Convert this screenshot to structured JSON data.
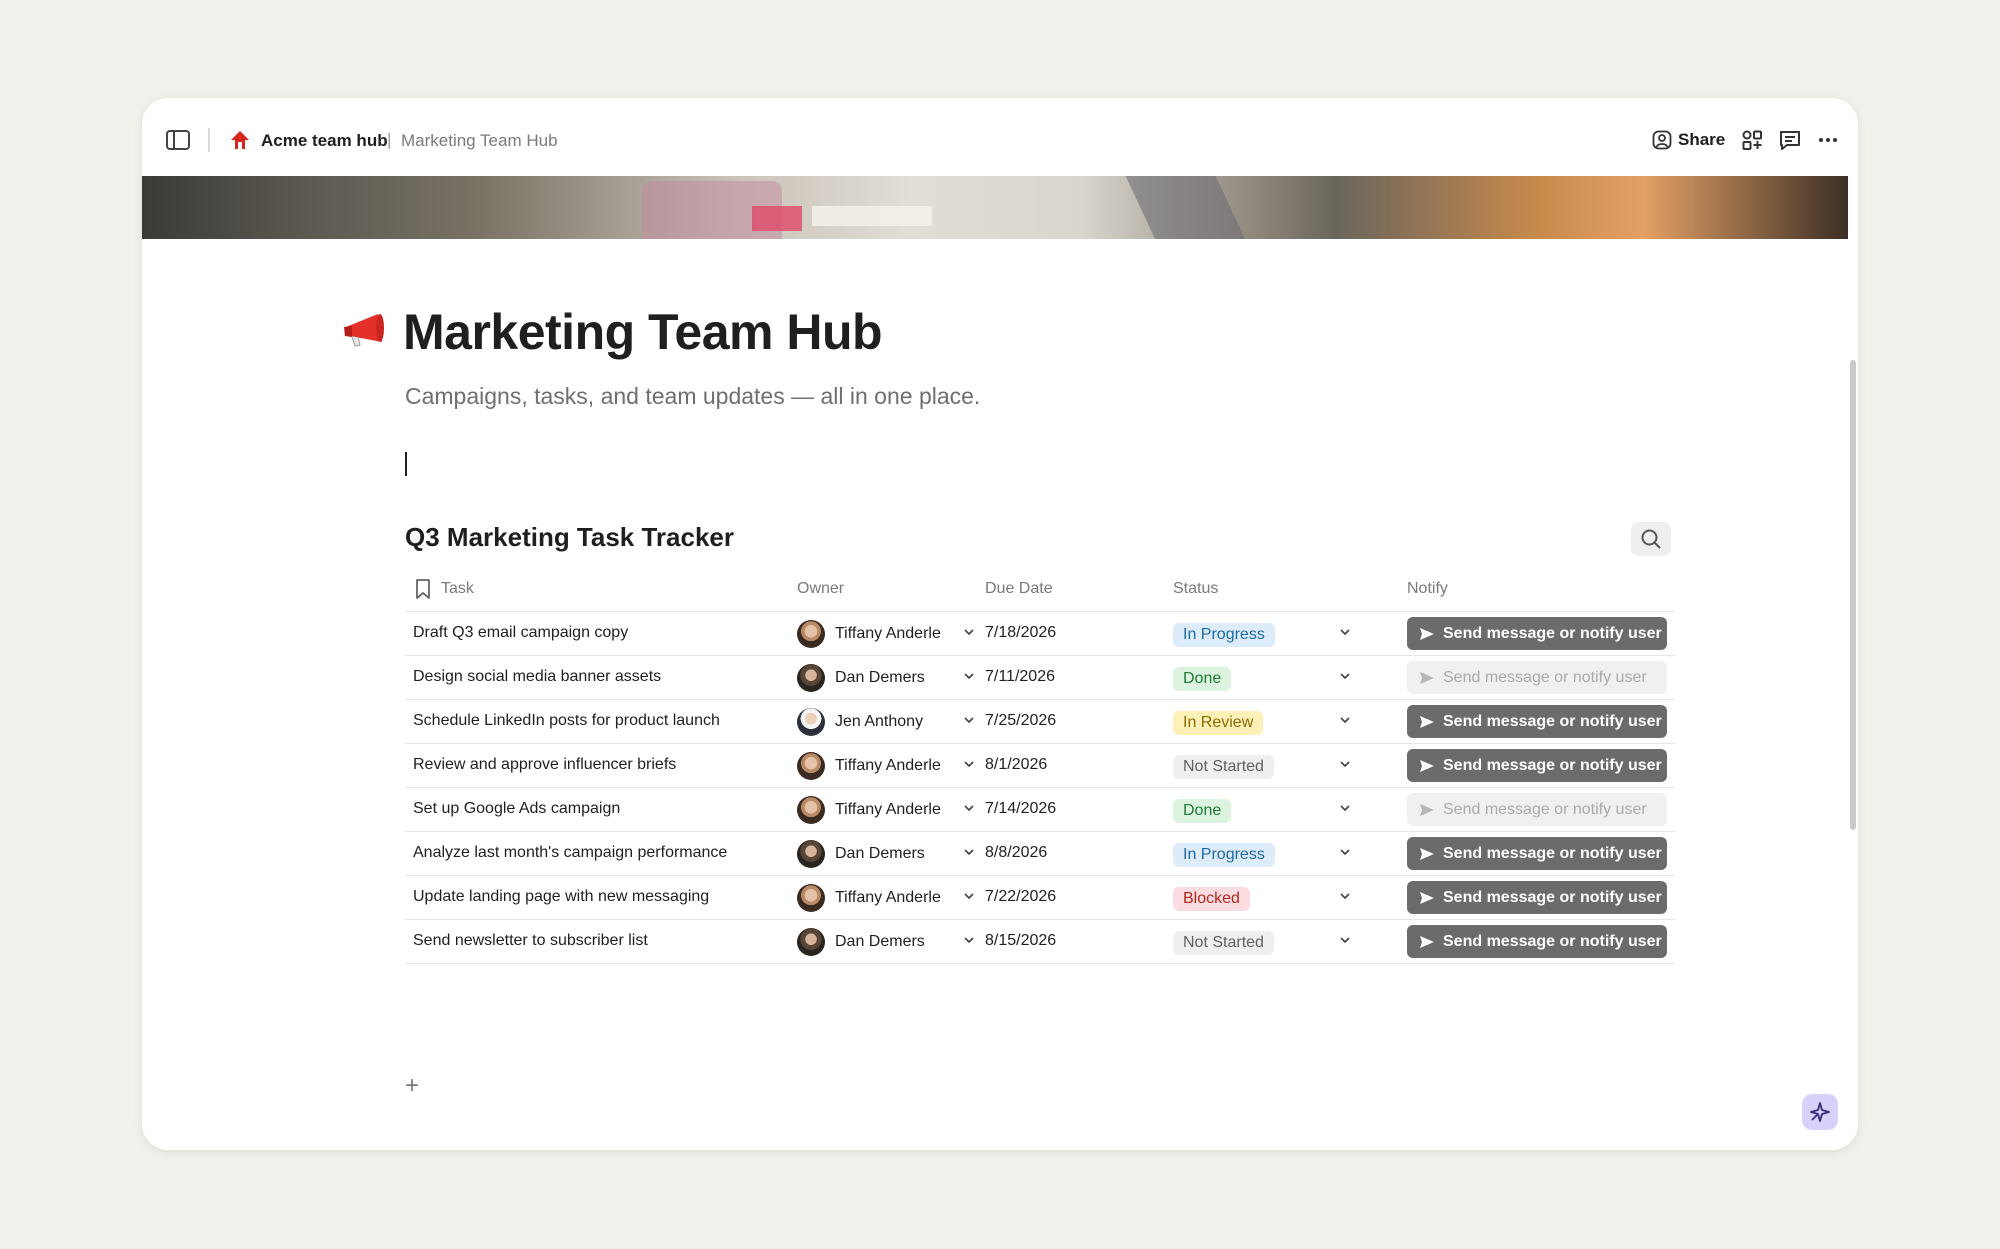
{
  "breadcrumb": {
    "workspace": "Acme team hub",
    "separator": "|",
    "page": "Marketing Team Hub"
  },
  "toolbar": {
    "share_label": "Share"
  },
  "page": {
    "emoji_icon": "megaphone-icon",
    "title": "Marketing Team Hub",
    "subtitle": "Campaigns, tasks, and team updates — all in one place."
  },
  "table": {
    "title": "Q3 Marketing Task Tracker",
    "columns": [
      "Task",
      "Owner",
      "Due Date",
      "Status",
      "Notify"
    ],
    "rows": [
      {
        "task": "Draft Q3 email campaign copy",
        "owner": "Tiffany Anderle",
        "due": "7/18/2026",
        "status": "In Progress",
        "notify": "Send message or notify user"
      },
      {
        "task": "Design social media banner assets",
        "owner": "Dan Demers",
        "due": "7/11/2026",
        "status": "Done",
        "notify": "Send message or notify user"
      },
      {
        "task": "Schedule LinkedIn posts for product launch",
        "owner": "Jen Anthony",
        "due": "7/25/2026",
        "status": "In Review",
        "notify": "Send message or notify user"
      },
      {
        "task": "Review and approve influencer briefs",
        "owner": "Tiffany Anderle",
        "due": "8/1/2026",
        "status": "Not Started",
        "notify": "Send message or notify user"
      },
      {
        "task": "Set up Google Ads campaign",
        "owner": "Tiffany Anderle",
        "due": "7/14/2026",
        "status": "Done",
        "notify": "Send message or notify user"
      },
      {
        "task": "Analyze last month's campaign performance",
        "owner": "Dan Demers",
        "due": "8/8/2026",
        "status": "In Progress",
        "notify": "Send message or notify user"
      },
      {
        "task": "Update landing page with new messaging",
        "owner": "Tiffany Anderle",
        "due": "7/22/2026",
        "status": "Blocked",
        "notify": "Send message or notify user"
      },
      {
        "task": "Send newsletter to subscriber list",
        "owner": "Dan Demers",
        "due": "8/15/2026",
        "status": "Not Started",
        "notify": "Send message or notify user"
      }
    ],
    "add_row_label": "+"
  },
  "status_colors": {
    "In Progress": {
      "bg": "#dcecfa",
      "fg": "#1e6aa8"
    },
    "Done": {
      "bg": "#dcf3df",
      "fg": "#1f7a35"
    },
    "In Review": {
      "bg": "#fdf1b8",
      "fg": "#8a6a00"
    },
    "Not Started": {
      "bg": "#efefef",
      "fg": "#5f5f5f"
    },
    "Blocked": {
      "bg": "#fbdde1",
      "fg": "#b3261e"
    }
  },
  "icons": {
    "sidebar": "sidebar-toggle-icon",
    "workspace": "house-icon",
    "share": "person-icon",
    "apps": "apps-icon",
    "comments": "comment-icon",
    "more": "more-icon",
    "search": "search-icon",
    "send": "send-icon",
    "ai": "sparkle-icon"
  }
}
